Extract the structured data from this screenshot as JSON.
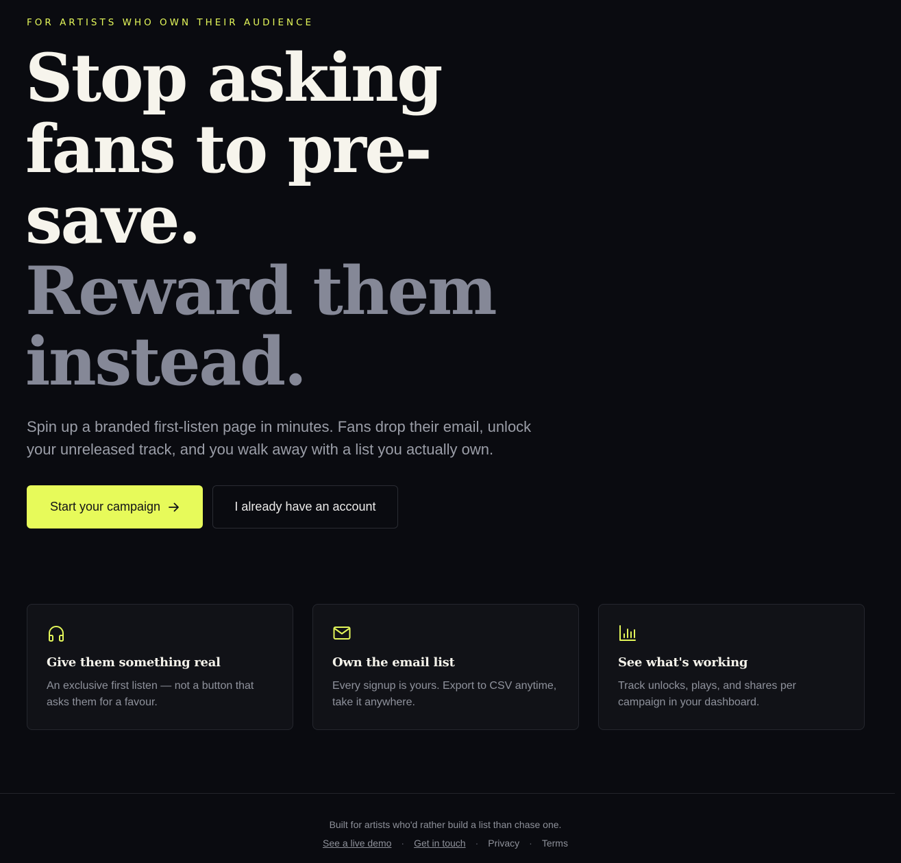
{
  "hero": {
    "eyebrow": "FOR ARTISTS WHO OWN THEIR AUDIENCE",
    "headline_lines": [
      "Stop asking",
      "fans to pre-",
      "save."
    ],
    "headline_muted_lines": [
      "Reward them",
      "instead."
    ],
    "subtext": "Spin up a branded first-listen page in minutes. Fans drop their email, unlock your unreleased track, and you walk away with a list you actually own.",
    "primary_cta": "Start your campaign",
    "secondary_cta": "I already have an account"
  },
  "features": [
    {
      "icon": "headphones-icon",
      "title": "Give them something real",
      "body": "An exclusive first listen — not a button that asks them for a favour."
    },
    {
      "icon": "mail-icon",
      "title": "Own the email list",
      "body": "Every signup is yours. Export to CSV anytime, take it anywhere."
    },
    {
      "icon": "bar-chart-icon",
      "title": "See what's working",
      "body": "Track unlocks, plays, and shares per campaign in your dashboard."
    }
  ],
  "footer": {
    "note": "Built for artists who'd rather build a list than chase one.",
    "links": [
      "See a live demo",
      "Get in touch",
      "Privacy",
      "Terms"
    ],
    "separator": "·"
  },
  "colors": {
    "accent": "#e7fa5a",
    "background": "#0a0b10",
    "card": "#111217",
    "headline": "#f6f4ec",
    "headline_muted": "#858897"
  }
}
